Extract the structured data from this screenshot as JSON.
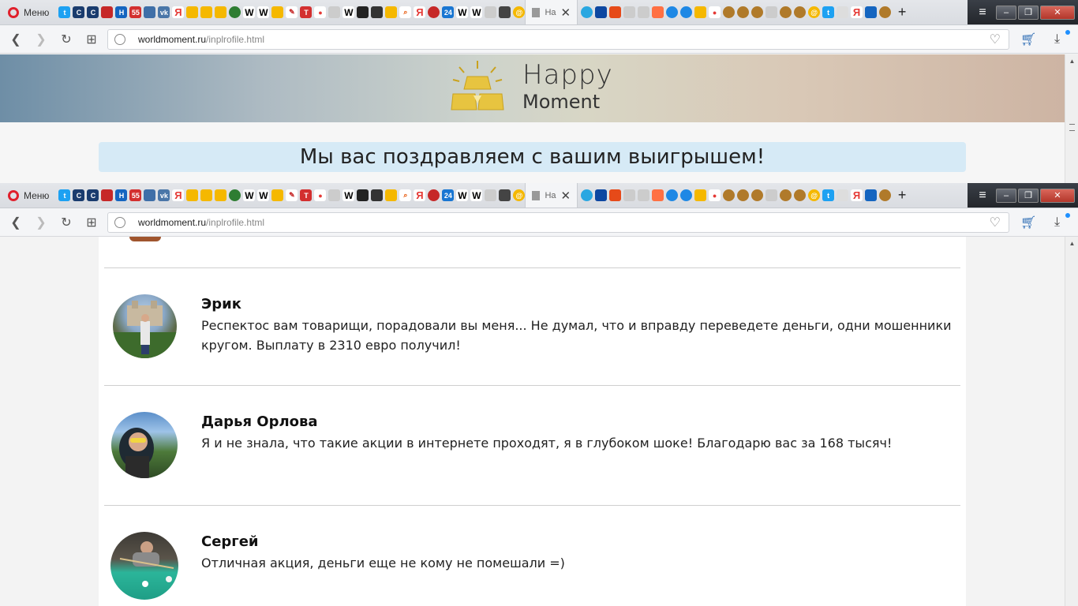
{
  "browser": {
    "menu_label": "Меню",
    "active_tab_title": "На",
    "tab_close": "✕",
    "new_tab": "+",
    "tab_menu": "≡",
    "url_host": "worldmoment.ru",
    "url_path": "/inplrofile.html",
    "icons": {
      "back": "back-icon",
      "forward": "forward-icon",
      "reload": "reload-icon",
      "speed_dial": "grid-icon",
      "bookmark": "heart-icon",
      "cart": "cart-icon",
      "download": "download-icon"
    },
    "win_minimize": "–",
    "win_maximize": "❐",
    "win_close": "✕"
  },
  "site": {
    "logo_line1": "Happy",
    "logo_line2": "Moment",
    "banner_title": "Мы вас поздравляем с вашим выигрышем!",
    "colors": {
      "banner_bg": "#d6eaf6",
      "gold": "#e7c440"
    }
  },
  "reviews": [
    {
      "name": "Эрик",
      "text": "Респектос вам товарищи, порадовали вы меня... Не думал, что и вправду переведете деньги, одни мошенники кругом. Выплату в 2310 евро получил!"
    },
    {
      "name": "Дарья Орлова",
      "text": "Я и не знала, что такие акции в интернете проходят, я в глубоком шоке! Благодарю вас за 168 тысяч!"
    },
    {
      "name": "Сергей",
      "text": "Отличная акция, деньги еще не кому не помешали =)"
    }
  ]
}
